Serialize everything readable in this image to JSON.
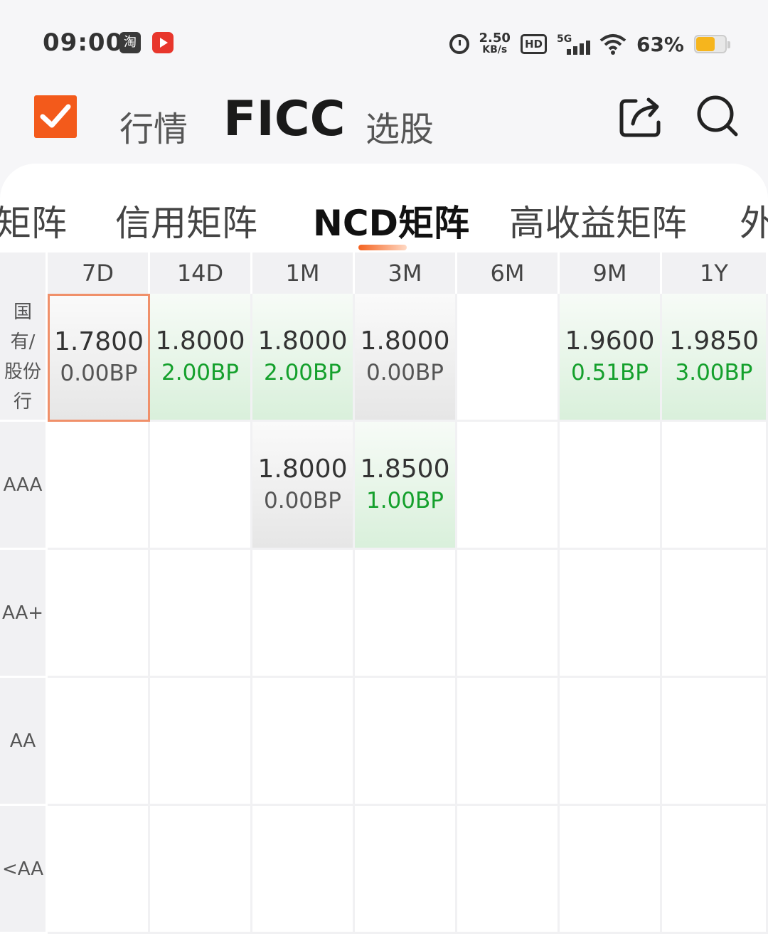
{
  "status_bar": {
    "time": "09:00",
    "app1_glyph": "淘",
    "speed_value": "2.50",
    "speed_unit": "KB/s",
    "hd": "HD",
    "network": "5G",
    "battery_pct": "63%",
    "battery_color": "#f6b51d"
  },
  "header": {
    "tabs": [
      "行情",
      "FICC",
      "选股"
    ],
    "active_tab": "FICC",
    "accent_color": "#f35a1b"
  },
  "subtabs": {
    "items": [
      "矩阵",
      "信用矩阵",
      "NCD矩阵",
      "高收益矩阵",
      "外"
    ],
    "active": "NCD矩阵"
  },
  "matrix": {
    "columns": [
      "7D",
      "14D",
      "1M",
      "3M",
      "6M",
      "9M",
      "1Y"
    ],
    "rows": [
      "国有/股份行",
      "AAA",
      "AA+",
      "AA",
      "<AA"
    ],
    "row_label_lines": [
      [
        "国",
        "有/",
        "股份",
        "行"
      ],
      [
        "AAA"
      ],
      [
        "AA+"
      ],
      [
        "AA"
      ],
      [
        "<AA"
      ]
    ],
    "cells": [
      [
        {
          "rate": "1.7800",
          "bp": "0.00BP",
          "trend": "flat",
          "selected": true
        },
        {
          "rate": "1.8000",
          "bp": "2.00BP",
          "trend": "up"
        },
        {
          "rate": "1.8000",
          "bp": "2.00BP",
          "trend": "up"
        },
        {
          "rate": "1.8000",
          "bp": "0.00BP",
          "trend": "flat"
        },
        null,
        {
          "rate": "1.9600",
          "bp": "0.51BP",
          "trend": "up"
        },
        {
          "rate": "1.9850",
          "bp": "3.00BP",
          "trend": "up"
        }
      ],
      [
        null,
        null,
        {
          "rate": "1.8000",
          "bp": "0.00BP",
          "trend": "flat"
        },
        {
          "rate": "1.8500",
          "bp": "1.00BP",
          "trend": "up"
        },
        null,
        null,
        null
      ],
      [
        null,
        null,
        null,
        null,
        null,
        null,
        null
      ],
      [
        null,
        null,
        null,
        null,
        null,
        null,
        null
      ],
      [
        null,
        null,
        null,
        null,
        null,
        null,
        null
      ]
    ],
    "colors": {
      "up": "#14a02c",
      "flat": "#555555",
      "selected_border": "#f0906a"
    }
  }
}
